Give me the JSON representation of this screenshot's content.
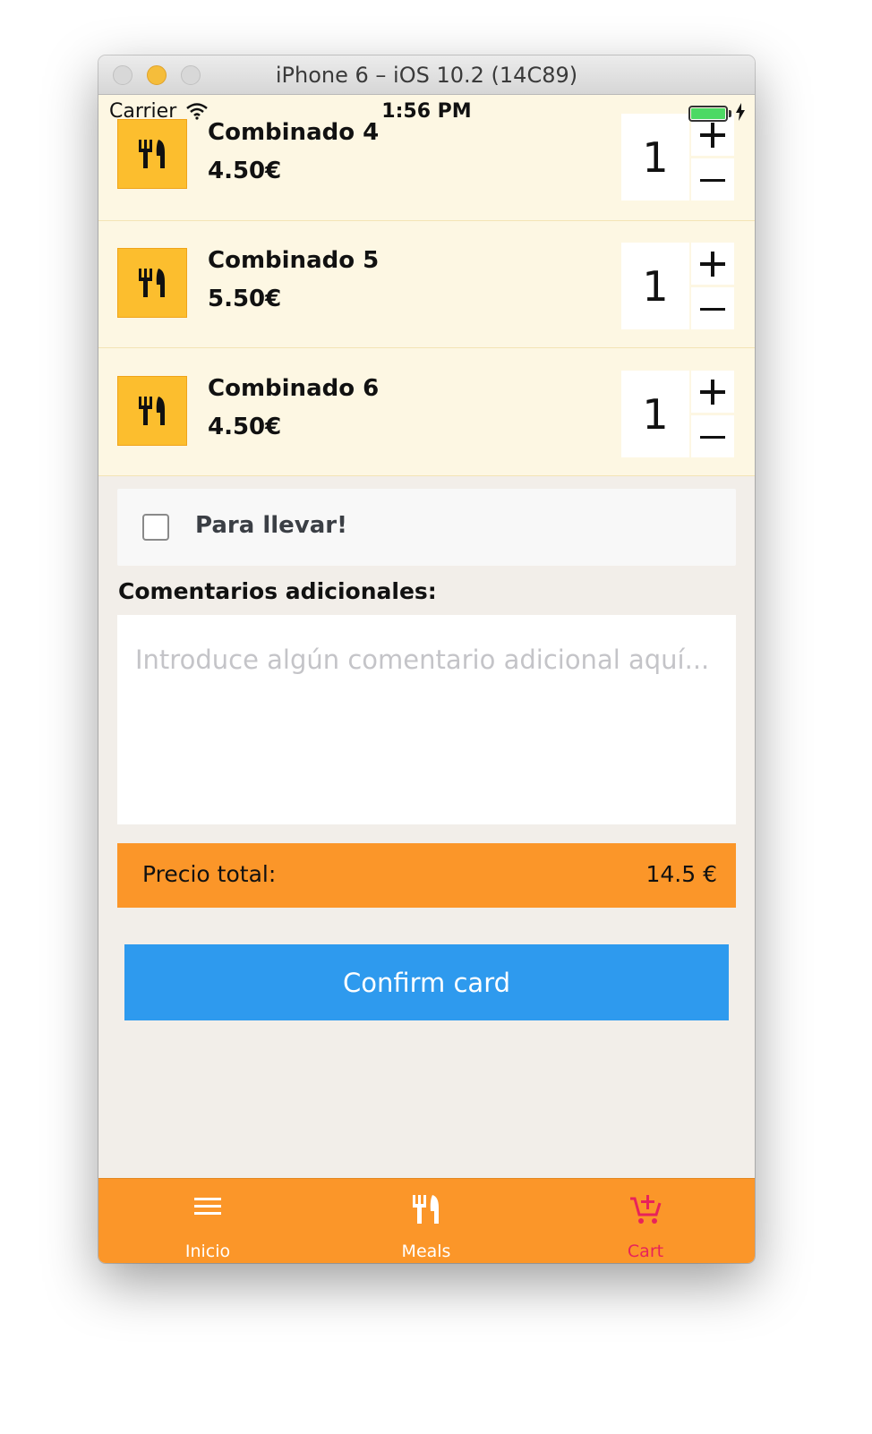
{
  "window": {
    "title": "iPhone 6 – iOS 10.2 (14C89)"
  },
  "status_bar": {
    "carrier": "Carrier",
    "time": "1:56 PM"
  },
  "cart": {
    "items": [
      {
        "name": "Combinado 4",
        "price": "4.50€",
        "quantity": "1",
        "icon": "fork-knife-icon"
      },
      {
        "name": "Combinado 5",
        "price": "5.50€",
        "quantity": "1",
        "icon": "fork-knife-icon"
      },
      {
        "name": "Combinado 6",
        "price": "4.50€",
        "quantity": "1",
        "icon": "fork-knife-icon"
      }
    ]
  },
  "takeaway": {
    "label": "Para llevar!",
    "checked": false
  },
  "comments": {
    "label": "Comentarios adicionales:",
    "placeholder": "Introduce algún comentario adicional aquí...",
    "value": ""
  },
  "total": {
    "label": "Precio total:",
    "value": "14.5 €"
  },
  "confirm": {
    "label": "Confirm card"
  },
  "tabbar": {
    "tabs": [
      {
        "label": "Inicio",
        "icon": "menu-icon",
        "active": false
      },
      {
        "label": "Meals",
        "icon": "fork-knife-icon",
        "active": false
      },
      {
        "label": "Cart",
        "icon": "cart-add-icon",
        "active": true
      }
    ]
  },
  "colors": {
    "accent_orange": "#fb9629",
    "item_background": "#fdf7e3",
    "item_icon": "#fcbe2e",
    "confirm_blue": "#2e9aee",
    "active_tab": "#e8235a"
  }
}
